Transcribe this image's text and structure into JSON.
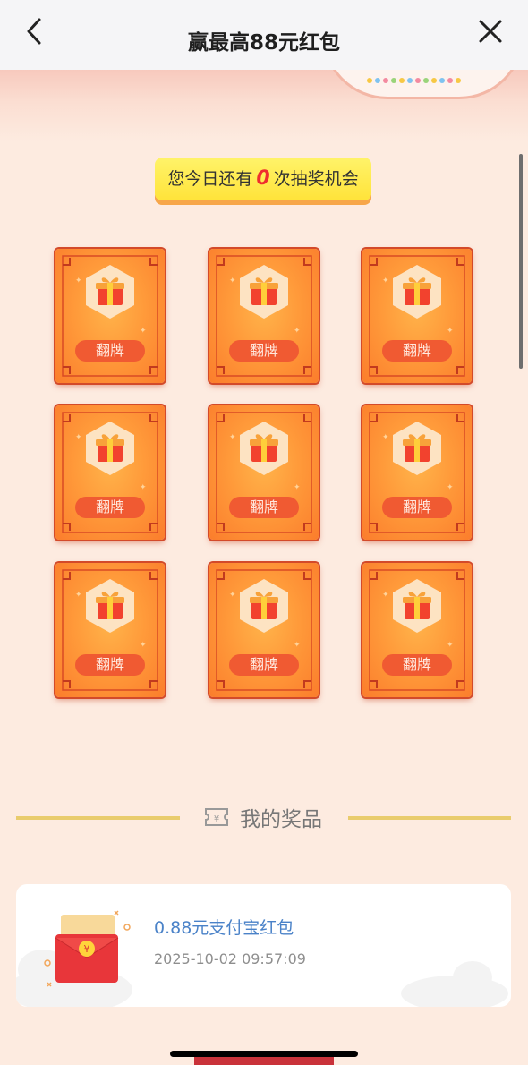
{
  "navbar": {
    "title": "赢最高88元红包",
    "back_icon": "chevron-left-icon",
    "close_icon": "close-icon"
  },
  "chances": {
    "prefix": "您今日还有",
    "count": "0",
    "suffix": "次抽奖机会"
  },
  "cards": [
    {
      "label": "翻牌"
    },
    {
      "label": "翻牌"
    },
    {
      "label": "翻牌"
    },
    {
      "label": "翻牌"
    },
    {
      "label": "翻牌"
    },
    {
      "label": "翻牌"
    },
    {
      "label": "翻牌"
    },
    {
      "label": "翻牌"
    },
    {
      "label": "翻牌"
    }
  ],
  "prizes": {
    "title": "我的奖品",
    "items": [
      {
        "name": "0.88元支付宝红包",
        "time": "2025-10-02 09:57:09"
      }
    ]
  },
  "colors": {
    "accent_red": "#ef2e2e",
    "card_orange": "#ff9a3a",
    "prize_blue": "#4a82c8",
    "pill_yellow": "#ffe33a"
  }
}
